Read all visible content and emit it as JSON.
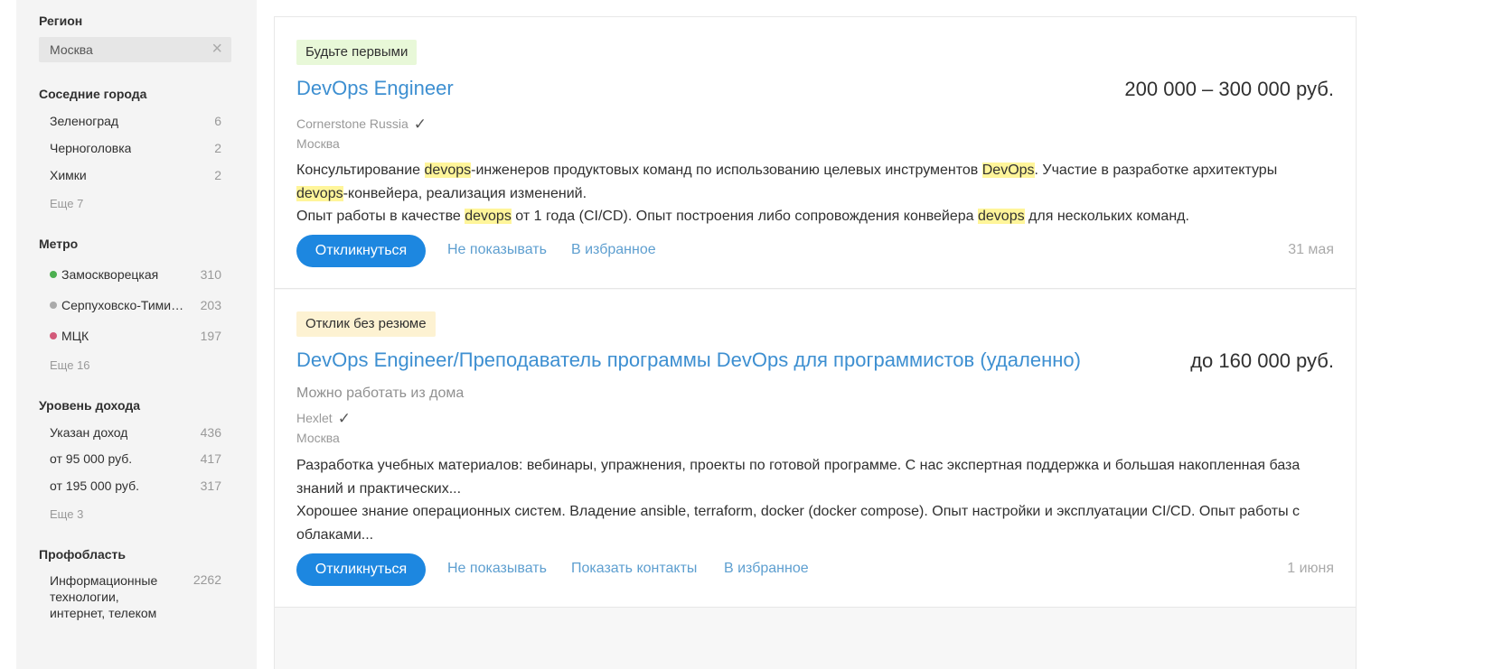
{
  "sidebar": {
    "region": {
      "title": "Регион",
      "value": "Москва",
      "clear_icon": "close-icon"
    },
    "nearby": {
      "title": "Соседние города",
      "items": [
        {
          "label": "Зеленоград",
          "count": "6"
        },
        {
          "label": "Черноголовка",
          "count": "2"
        },
        {
          "label": "Химки",
          "count": "2"
        }
      ],
      "more": "Еще 7"
    },
    "metro": {
      "title": "Метро",
      "items": [
        {
          "label": "Замоскворецкая",
          "count": "310",
          "color": "#4caf50"
        },
        {
          "label": "Серпуховско-Тимирязевская",
          "count": "203",
          "color": "#aaaaaa"
        },
        {
          "label": "МЦК",
          "count": "197",
          "color": "#d35a7a"
        }
      ],
      "more": "Еще 16"
    },
    "income": {
      "title": "Уровень дохода",
      "items": [
        {
          "label": "Указан доход",
          "count": "436"
        },
        {
          "label": "от 95 000 руб.",
          "count": "417"
        },
        {
          "label": "от 195 000 руб.",
          "count": "317"
        }
      ],
      "more": "Еще 3"
    },
    "prof": {
      "title": "Профобласть",
      "items": [
        {
          "label": "Информационные технологии, интернет, телеком",
          "count": "2262"
        }
      ]
    }
  },
  "vacancies": [
    {
      "badge": "Будьте первыми",
      "title": "DevOps Engineer",
      "salary": "200 000 – 300 000 руб.",
      "company": "Cornerstone Russia",
      "verified_icon": "check-icon",
      "city": "Москва",
      "desc1": {
        "t1": "Консультирование ",
        "h1": "devops",
        "t2": "-инженеров продуктовых команд по использованию целевых инструментов ",
        "h2": "DevOps",
        "t3": ". Участие в разработке архитектуры ",
        "h3": "devops",
        "t4": "-конвейера, реализация изменений."
      },
      "desc2": {
        "t1": "Опыт работы в качестве ",
        "h1": "devops",
        "t2": " от 1 года (CI/CD). Опыт построения либо сопровождения конвейера ",
        "h2": "devops",
        "t3": " для нескольких команд."
      },
      "apply": "Откликнуться",
      "hide": "Не показывать",
      "favorite": "В избранное",
      "date": "31 мая"
    },
    {
      "badge": "Отклик без резюме",
      "title": "DevOps Engineer/Преподаватель программы DevOps для программистов (удаленно)",
      "salary": "до 160 000 руб.",
      "remote": "Можно работать из дома",
      "company": "Hexlet",
      "verified_icon": "check-icon",
      "city": "Москва",
      "desc1": "Разработка учебных материалов: вебинары, упражнения, проекты по готовой программе. С нас экспертная поддержка и большая накопленная база знаний и практических...",
      "desc2": "Хорошее знание операционных систем. Владение ansible, terraform, docker (docker compose). Опыт настройки и эксплуатации CI/CD. Опыт работы с облаками...",
      "apply": "Откликнуться",
      "hide": "Не показывать",
      "contacts": "Показать контакты",
      "favorite": "В избранное",
      "date": "1 июня"
    }
  ],
  "colors": {
    "accent": "#1d87e0",
    "link": "#3d8fd1",
    "highlight": "#fff59a"
  }
}
